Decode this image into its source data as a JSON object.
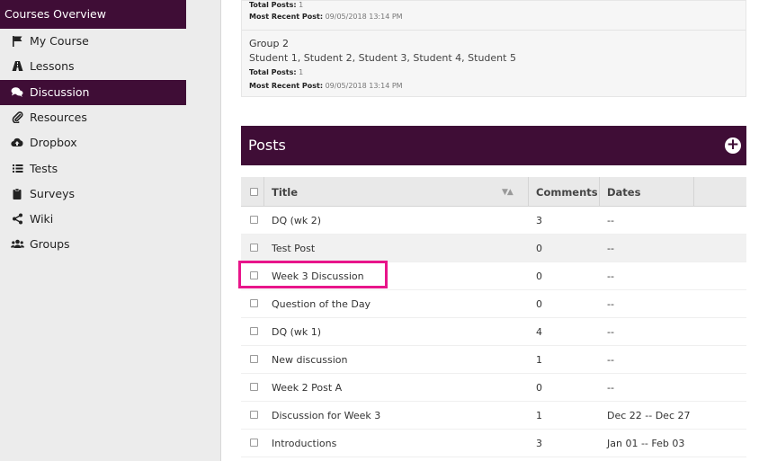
{
  "sidebar": {
    "header": "Courses Overview",
    "items": [
      {
        "label": "My Course",
        "icon": "flag-icon"
      },
      {
        "label": "Lessons",
        "icon": "road-icon"
      },
      {
        "label": "Discussion",
        "icon": "comments-icon",
        "active": true
      },
      {
        "label": "Resources",
        "icon": "paperclip-icon"
      },
      {
        "label": "Dropbox",
        "icon": "cloud-upload-icon"
      },
      {
        "label": "Tests",
        "icon": "list-icon"
      },
      {
        "label": "Surveys",
        "icon": "clipboard-icon"
      },
      {
        "label": "Wiki",
        "icon": "share-icon"
      },
      {
        "label": "Groups",
        "icon": "users-icon"
      }
    ]
  },
  "groups": {
    "top": {
      "total_posts_label": "Total Posts:",
      "total_posts": "1",
      "recent_label": "Most Recent Post:",
      "recent": "09/05/2018 13:14 PM"
    },
    "group2": {
      "name": "Group 2",
      "members": "Student 1, Student 2, Student 3, Student 4, Student 5",
      "total_posts_label": "Total Posts:",
      "total_posts": "1",
      "recent_label": "Most Recent Post:",
      "recent": "09/05/2018 13:14 PM"
    }
  },
  "posts": {
    "title": "Posts",
    "add_icon": "+",
    "columns": {
      "title": "Title",
      "comments": "Comments",
      "dates": "Dates"
    },
    "sort_icon": "▼▲",
    "rows": [
      {
        "title": "DQ (wk 2)",
        "comments": "3",
        "dates": "--"
      },
      {
        "title": "Test Post",
        "comments": "0",
        "dates": "--"
      },
      {
        "title": "Week 3 Discussion",
        "comments": "0",
        "dates": "--"
      },
      {
        "title": "Question of the Day",
        "comments": "0",
        "dates": "--"
      },
      {
        "title": "DQ (wk 1)",
        "comments": "4",
        "dates": "--"
      },
      {
        "title": "New discussion",
        "comments": "1",
        "dates": "--"
      },
      {
        "title": "Week 2 Post A",
        "comments": "0",
        "dates": "--"
      },
      {
        "title": "Discussion for Week 3",
        "comments": "1",
        "dates": "Dec 22 -- Dec 27"
      },
      {
        "title": "Introductions",
        "comments": "3",
        "dates": "Jan 01 -- Feb 03"
      }
    ]
  },
  "colors": {
    "brand": "#3f0d36",
    "highlight": "#e8158a"
  }
}
